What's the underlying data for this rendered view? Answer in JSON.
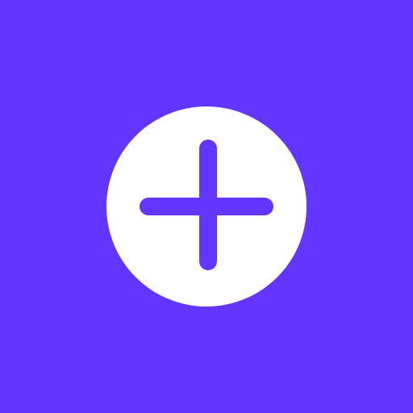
{
  "app": {
    "background_color": "#6236FF"
  },
  "add_button": {
    "icon": "plus-icon",
    "circle_color": "#FFFFFF",
    "icon_color": "#6236FF"
  }
}
